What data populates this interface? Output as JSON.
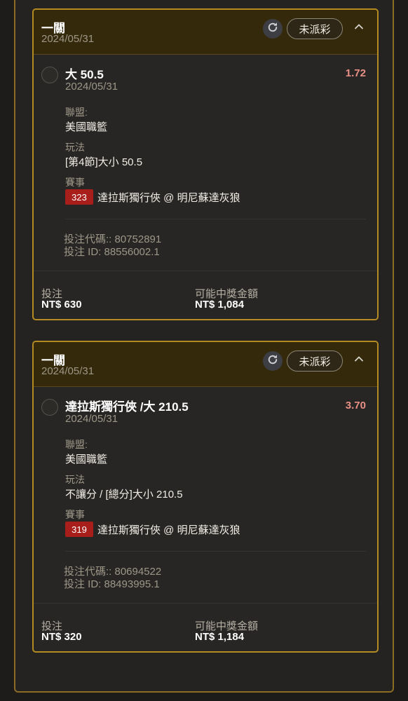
{
  "colors": {
    "accent_border": "#b38b22",
    "header_bg": "#35290b",
    "odds": "#e89086",
    "match_badge": "#a81e1a"
  },
  "icons": {
    "refresh": "refresh-icon",
    "collapse": "chevron-up-icon"
  },
  "bets": [
    {
      "title": "一關",
      "date": "2024/05/31",
      "status": "未派彩",
      "selection": "大 50.5",
      "selection_date": "2024/05/31",
      "odds": "1.72",
      "league_label": "聯盟:",
      "league": "美國職籃",
      "play_label": "玩法",
      "play": "[第4節]大小 50.5",
      "event_label": "賽事",
      "match_no": "323",
      "event": "達拉斯獨行俠 @ 明尼蘇達灰狼",
      "bet_code": "投注代碼:: 80752891",
      "bet_id": "投注 ID: 88556002.1",
      "stake_label": "投注",
      "stake": "NT$ 630",
      "payout_label": "可能中獎金額",
      "payout": "NT$ 1,084"
    },
    {
      "title": "一關",
      "date": "2024/05/31",
      "status": "未派彩",
      "selection": "達拉斯獨行俠 /大 210.5",
      "selection_date": "2024/05/31",
      "odds": "3.70",
      "league_label": "聯盟:",
      "league": "美國職籃",
      "play_label": "玩法",
      "play": "不讓分 / [總分]大小 210.5",
      "event_label": "賽事",
      "match_no": "319",
      "event": "達拉斯獨行俠 @ 明尼蘇達灰狼",
      "bet_code": "投注代碼:: 80694522",
      "bet_id": "投注 ID: 88493995.1",
      "stake_label": "投注",
      "stake": "NT$ 320",
      "payout_label": "可能中獎金額",
      "payout": "NT$ 1,184"
    }
  ]
}
